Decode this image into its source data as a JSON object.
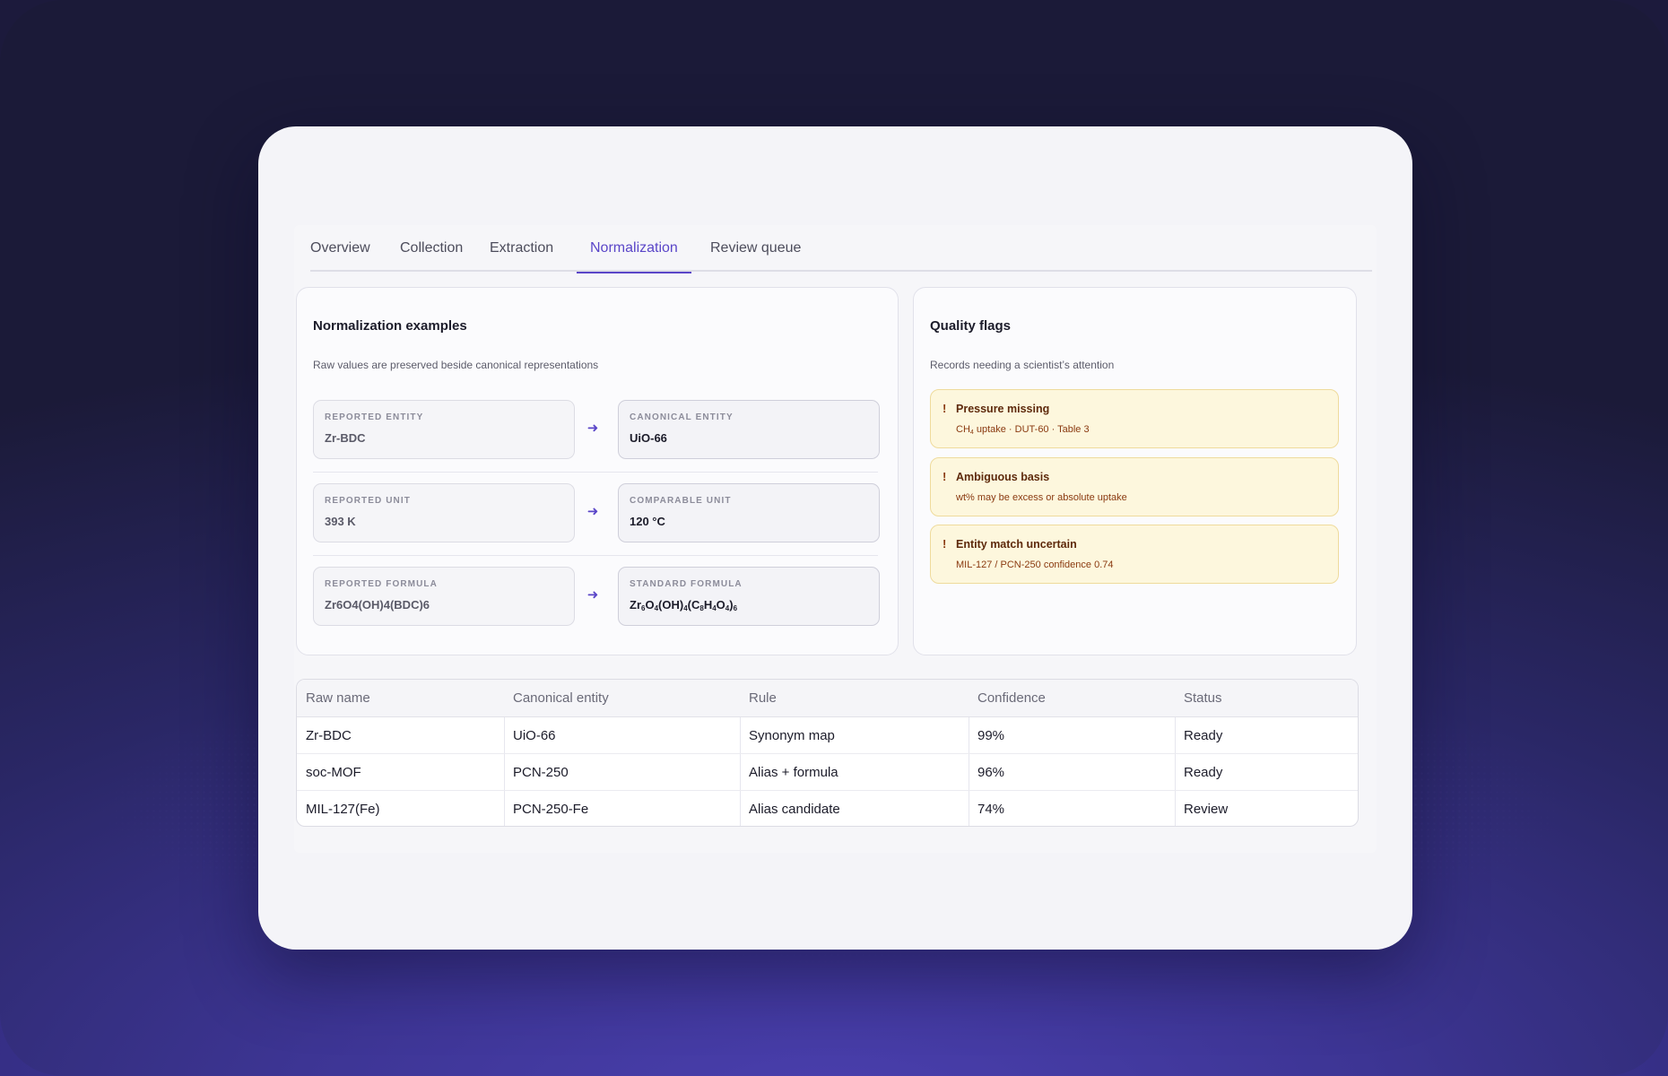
{
  "tabs": [
    {
      "label": "Overview"
    },
    {
      "label": "Collection"
    },
    {
      "label": "Extraction"
    },
    {
      "label": "Normalization",
      "active": true
    },
    {
      "label": "Review queue"
    }
  ],
  "normalization": {
    "title": "Normalization examples",
    "subtitle": "Raw values are preserved beside canonical representations",
    "rows": [
      {
        "raw_label": "Reported entity",
        "raw_value": "Zr-BDC",
        "canon_label": "Canonical entity",
        "canon_value": "UiO-66"
      },
      {
        "raw_label": "Reported unit",
        "raw_value": "393 K",
        "canon_label": "Comparable unit",
        "canon_value": "120 °C"
      },
      {
        "raw_label": "Reported formula",
        "raw_value": "Zr6O4(OH)4(BDC)6",
        "canon_label": "Standard formula",
        "canon_value": "Zr6O4(OH)4(C8H4O4)6"
      }
    ]
  },
  "quality": {
    "title": "Quality flags",
    "subtitle": "Records needing a scientist’s attention",
    "flags": [
      {
        "icon": "!",
        "title": "Pressure missing",
        "detail": "CH4 uptake · DUT-60 · Table 3"
      },
      {
        "icon": "!",
        "title": "Ambiguous basis",
        "detail": "wt% may be excess or absolute uptake"
      },
      {
        "icon": "!",
        "title": "Entity match uncertain",
        "detail": "MIL-127 / PCN-250 confidence 0.74"
      }
    ]
  },
  "table": {
    "headers": [
      "Raw name",
      "Canonical entity",
      "Rule",
      "Confidence",
      "Status"
    ],
    "rows": [
      [
        "Zr-BDC",
        "UiO-66",
        "Synonym map",
        "99%",
        "Ready"
      ],
      [
        "soc-MOF",
        "PCN-250",
        "Alias + formula",
        "96%",
        "Ready"
      ],
      [
        "MIL-127(Fe)",
        "PCN-250-Fe",
        "Alias candidate",
        "74%",
        "Review"
      ]
    ]
  },
  "colors": {
    "accent": "#5a46c8",
    "flag_bg": "#fdf7dd",
    "flag_text": "#5e2a0c"
  }
}
